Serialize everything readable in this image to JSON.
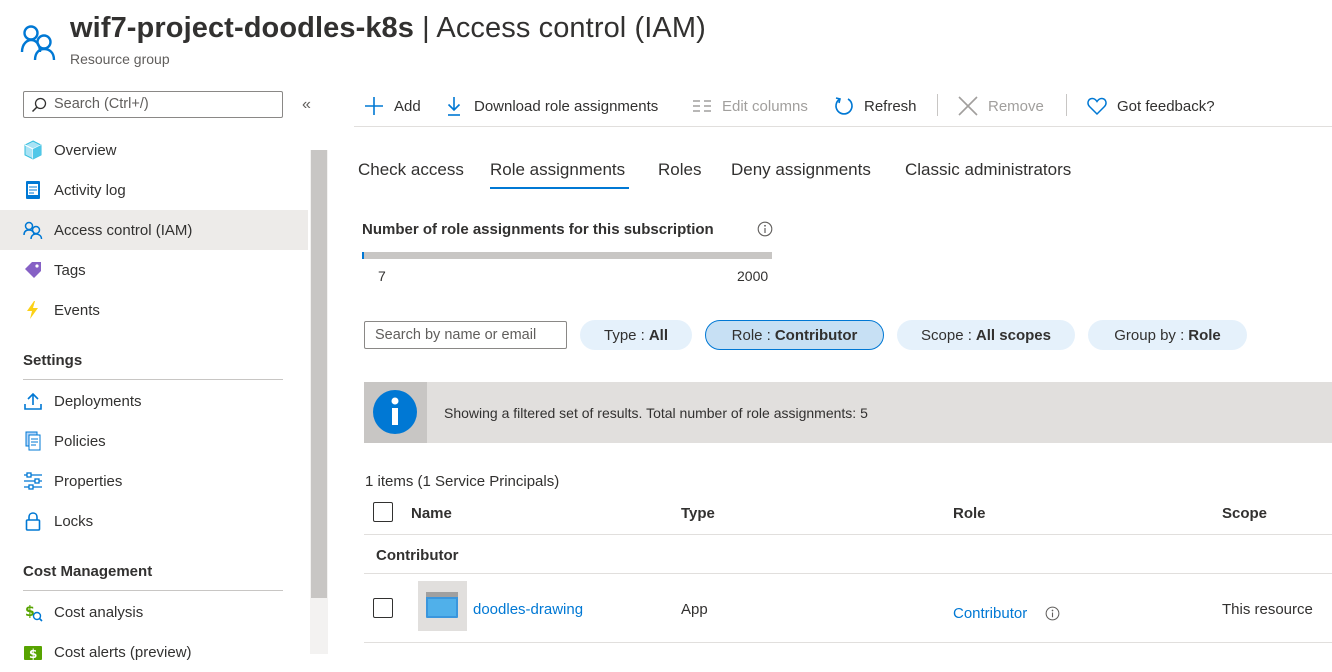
{
  "header": {
    "title_resource": "wif7-project-doodles-k8s",
    "title_separator": " | ",
    "title_page": "Access control (IAM)",
    "subtitle": "Resource group",
    "icon": "users-icon"
  },
  "sidebar": {
    "search_placeholder": "Search (Ctrl+/)",
    "collapse_label": "«",
    "items": [
      {
        "label": "Overview",
        "icon": "cube-icon"
      },
      {
        "label": "Activity log",
        "icon": "activity-log-icon"
      },
      {
        "label": "Access control (IAM)",
        "icon": "people-icon",
        "active": true
      },
      {
        "label": "Tags",
        "icon": "tag-icon"
      },
      {
        "label": "Events",
        "icon": "lightning-icon"
      }
    ],
    "sections": [
      {
        "title": "Settings",
        "items": [
          {
            "label": "Deployments",
            "icon": "upload-icon"
          },
          {
            "label": "Policies",
            "icon": "policy-icon"
          },
          {
            "label": "Properties",
            "icon": "sliders-icon"
          },
          {
            "label": "Locks",
            "icon": "lock-icon"
          }
        ]
      },
      {
        "title": "Cost Management",
        "items": [
          {
            "label": "Cost analysis",
            "icon": "cost-analysis-icon"
          },
          {
            "label": "Cost alerts (preview)",
            "icon": "cost-alerts-icon"
          }
        ]
      }
    ]
  },
  "toolbar": {
    "add": "Add",
    "download": "Download role assignments",
    "edit_columns": "Edit columns",
    "refresh": "Refresh",
    "remove": "Remove",
    "feedback": "Got feedback?"
  },
  "tabs": [
    {
      "label": "Check access"
    },
    {
      "label": "Role assignments",
      "active": true
    },
    {
      "label": "Roles"
    },
    {
      "label": "Deny assignments"
    },
    {
      "label": "Classic administrators"
    }
  ],
  "counter": {
    "title": "Number of role assignments for this subscription",
    "current": "7",
    "max": "2000",
    "fill_fraction": 0.0035
  },
  "filters": {
    "search_placeholder": "Search by name or email",
    "type_label": "Type :",
    "type_value": "All",
    "role_label": "Role :",
    "role_value": "Contributor",
    "scope_label": "Scope :",
    "scope_value": "All scopes",
    "group_label": "Group by :",
    "group_value": "Role"
  },
  "banner": {
    "text": "Showing a filtered set of results. Total number of role assignments: 5"
  },
  "table": {
    "items_count": "1 items (1 Service Principals)",
    "columns": [
      "Name",
      "Type",
      "Role",
      "Scope"
    ],
    "group": "Contributor",
    "rows": [
      {
        "name": "doodles-drawing",
        "type": "App",
        "role": "Contributor",
        "scope": "This resource"
      }
    ]
  },
  "colors": {
    "accent": "#0078d4",
    "selected_bg": "#edebe9",
    "pill_bg": "#e5f1fb"
  }
}
